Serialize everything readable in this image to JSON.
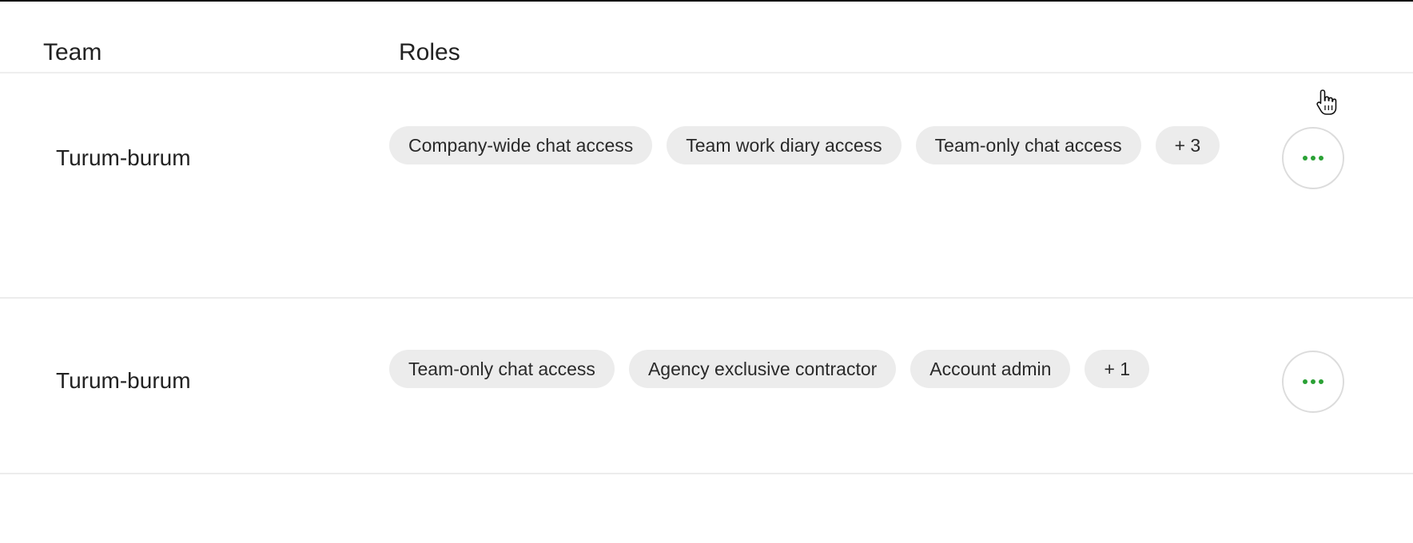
{
  "header": {
    "team_label": "Team",
    "roles_label": "Roles"
  },
  "rows": [
    {
      "team": "Turum-burum",
      "roles": [
        "Company-wide chat access",
        "Team work diary access",
        "Team-only chat access"
      ],
      "more": "+ 3"
    },
    {
      "team": "Turum-burum",
      "roles": [
        "Team-only chat access",
        "Agency exclusive contractor",
        "Account admin"
      ],
      "more": "+ 1"
    }
  ],
  "icons": {
    "row_actions": "more-horizontal-icon",
    "cursor": "hand-pointer-icon"
  },
  "colors": {
    "chip_bg": "#ececec",
    "dots": "#2aa135",
    "divider": "#ececec"
  }
}
